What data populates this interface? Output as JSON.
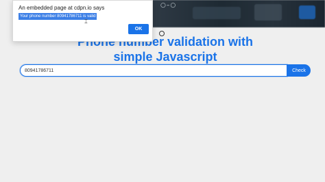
{
  "alert": {
    "title": "An embedded page at cdpn.io says",
    "message": "Your phone number 80941786711 is valid",
    "ok_label": "OK"
  },
  "video_controls": {
    "text": "○–○"
  },
  "header": {
    "title_line1": "Phone number validation with",
    "title_line2": "simple Javascript"
  },
  "form": {
    "phone_value": "80941786711",
    "check_label": "Check"
  },
  "colors": {
    "accent": "#1a73e8",
    "background": "#efefef",
    "highlight": "#3c7fe6"
  }
}
